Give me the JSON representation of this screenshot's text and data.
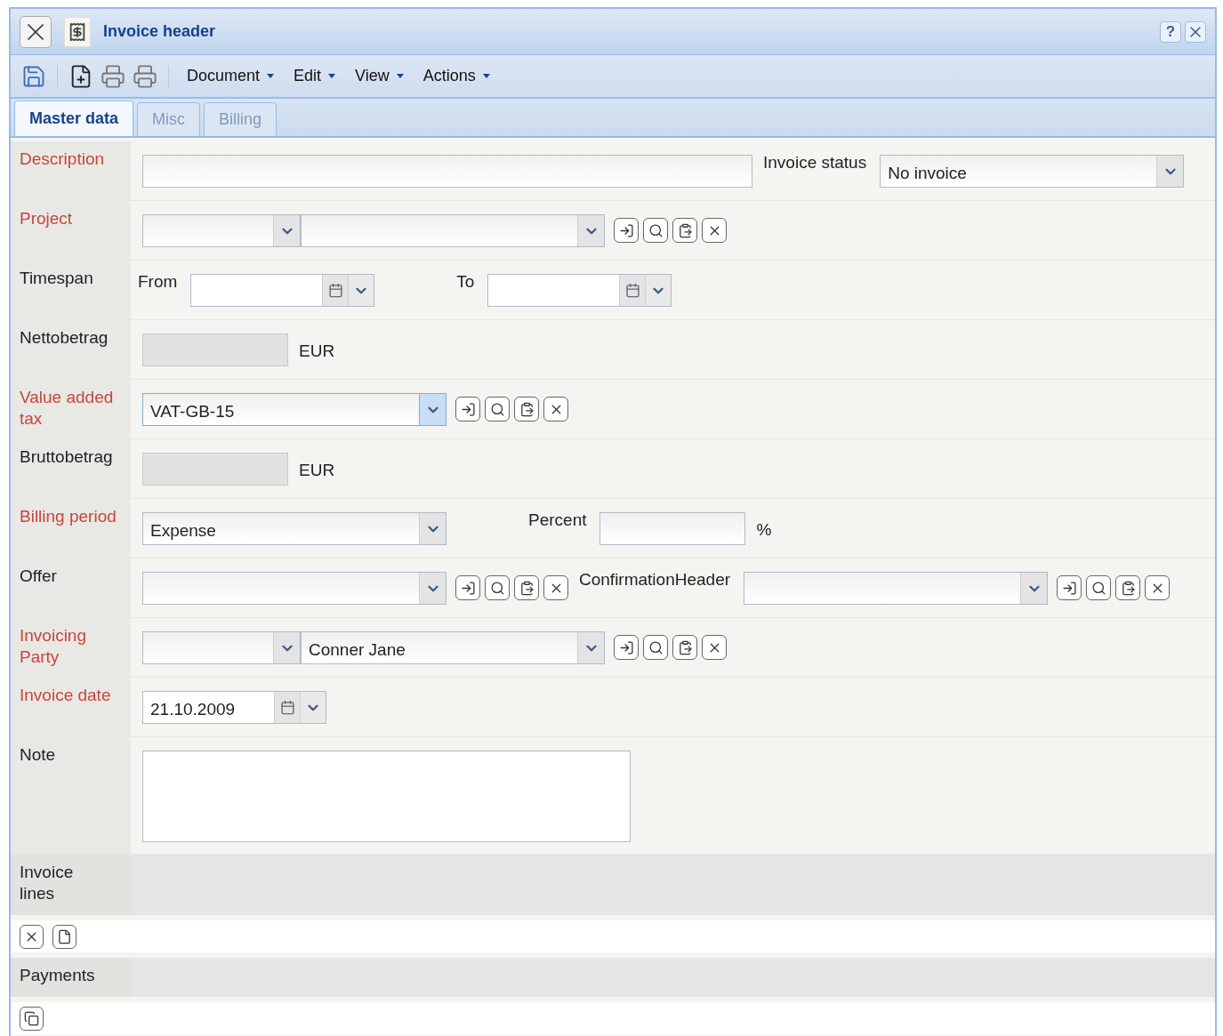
{
  "window": {
    "title": "Invoice header",
    "help": "?"
  },
  "toolbar": {
    "buttons": [
      {
        "kind": "save"
      },
      {
        "kind": "separator"
      },
      {
        "kind": "new"
      },
      {
        "kind": "print"
      },
      {
        "kind": "print"
      },
      {
        "kind": "separator"
      }
    ],
    "menus": [
      "Document",
      "Edit",
      "View",
      "Actions"
    ]
  },
  "tabs": [
    {
      "label": "Master data",
      "selected": true
    },
    {
      "label": "Misc",
      "selected": false
    },
    {
      "label": "Billing",
      "selected": false
    }
  ],
  "rows": [
    {
      "label": "Description",
      "required": true,
      "fields": [
        {
          "kind": "widetext"
        },
        {
          "kind": "label",
          "text": "Invoice status"
        },
        {
          "kind": "combo",
          "value": "No invoice",
          "focused": false
        }
      ]
    },
    {
      "label": "Project",
      "required": true,
      "fields": [
        {
          "kind": "shortcombo",
          "focused": false
        },
        {
          "kind": "combo",
          "focused": false
        },
        {
          "kind": "actions"
        }
      ]
    },
    {
      "label": "Timespan",
      "required": false,
      "fields": [
        {
          "kind": "label",
          "text": "From"
        },
        {
          "kind": "date"
        },
        {
          "kind": "label",
          "text": "To"
        },
        {
          "kind": "date"
        }
      ]
    },
    {
      "label": "Nettobetrag",
      "required": false,
      "fields": [
        {
          "kind": "readonly"
        },
        {
          "kind": "unit",
          "text": "EUR"
        }
      ]
    },
    {
      "label": "Value added tax",
      "required": true,
      "fields": [
        {
          "kind": "combo",
          "value": "VAT-GB-15",
          "focused": true
        },
        {
          "kind": "actions"
        }
      ]
    },
    {
      "label": "Bruttobetrag",
      "required": false,
      "fields": [
        {
          "kind": "readonly"
        },
        {
          "kind": "unit",
          "text": "EUR"
        }
      ]
    },
    {
      "label": "Billing period",
      "required": true,
      "fields": [
        {
          "kind": "combo",
          "value": "Expense",
          "focused": false
        },
        {
          "kind": "label",
          "text": "Percent"
        },
        {
          "kind": "text"
        },
        {
          "kind": "unit",
          "text": "%"
        }
      ]
    },
    {
      "label": "Offer",
      "required": false,
      "fields": [
        {
          "kind": "combo",
          "focused": false
        },
        {
          "kind": "actions"
        },
        {
          "kind": "label",
          "text": "ConfirmationHeader"
        },
        {
          "kind": "combo",
          "focused": false
        },
        {
          "kind": "actions"
        }
      ]
    },
    {
      "label": "Invoicing Party",
      "required": true,
      "fields": [
        {
          "kind": "shortcombo",
          "focused": false
        },
        {
          "kind": "combo",
          "value": "Conner Jane",
          "focused": false
        },
        {
          "kind": "actions"
        }
      ]
    },
    {
      "label": "Invoice date",
      "required": true,
      "fields": [
        {
          "kind": "date",
          "value": "21.10.2009"
        }
      ]
    },
    {
      "label": "Note",
      "required": false,
      "fields": [
        {
          "kind": "textarea"
        }
      ]
    }
  ],
  "sections": [
    {
      "title": "Invoice lines",
      "buttons": [
        {
          "kind": "delete"
        },
        {
          "kind": "new"
        }
      ]
    },
    {
      "title": "Payments",
      "buttons": [
        {
          "kind": "copy"
        }
      ]
    }
  ]
}
